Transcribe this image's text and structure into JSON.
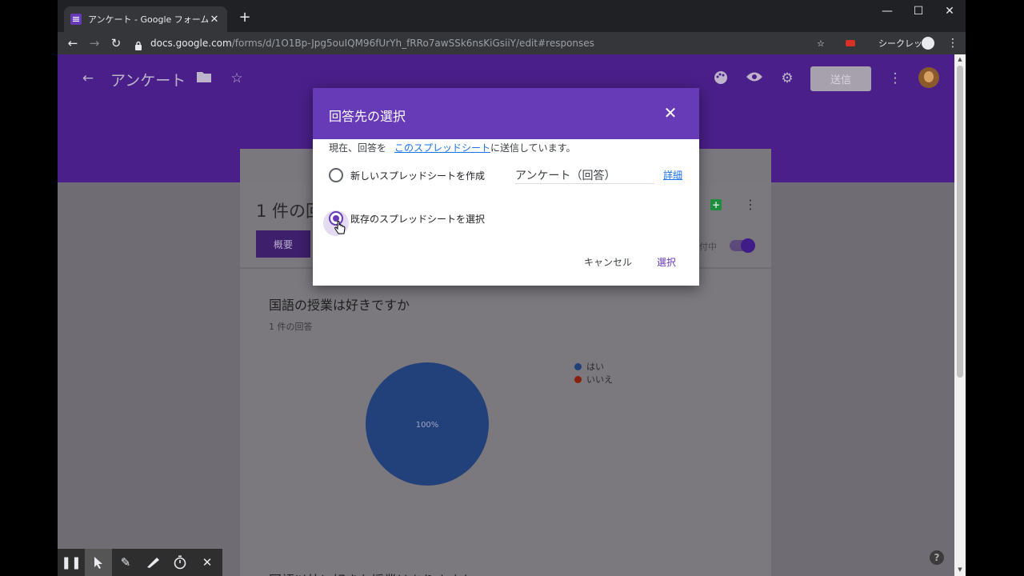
{
  "browser": {
    "tab_title": "アンケート - Google フォーム",
    "tab_close": "✕",
    "new_tab": "+",
    "url_host": "docs.google.com",
    "url_path": "/forms/d/1O1Bp-Jpg5ouIQM96fUrYh_fRRo7awSSk6nsKiGsiiY/edit#responses",
    "profile_label": "シークレット",
    "window_controls": [
      "—",
      "☐",
      "✕"
    ]
  },
  "forms_header": {
    "title": "アンケート",
    "send_label": "送信"
  },
  "responses": {
    "count_text": "1 件の回",
    "summary_tab": "概要",
    "accepting_text": "付中"
  },
  "question": {
    "title": "国語の授業は好きですか",
    "subtitle": "1 件の回答",
    "next_title": "国語以外に好きな授業はありますか"
  },
  "chart_data": {
    "type": "pie",
    "categories": [
      "はい",
      "いいえ"
    ],
    "values": [
      100,
      0
    ],
    "slice_label": "100%",
    "colors": [
      "#22407a",
      "#8a2010"
    ],
    "legend_position": "right"
  },
  "dialog": {
    "title": "回答先の選択",
    "close_label": "✕",
    "current_prefix": "現在、回答を",
    "current_link": "このスプレッドシート",
    "current_suffix": "に送信しています。",
    "option_new": "新しいスプレッドシートを作成",
    "new_sheet_name": "アンケート（回答）",
    "detail_link": "詳細",
    "option_existing": "既存のスプレッドシートを選択",
    "selected_option": "existing",
    "cancel_label": "キャンセル",
    "select_label": "選択"
  },
  "colors": {
    "accent": "#673ab7",
    "link": "#1a73e8",
    "header_overlay": "#4a1f8a"
  },
  "help_label": "?"
}
